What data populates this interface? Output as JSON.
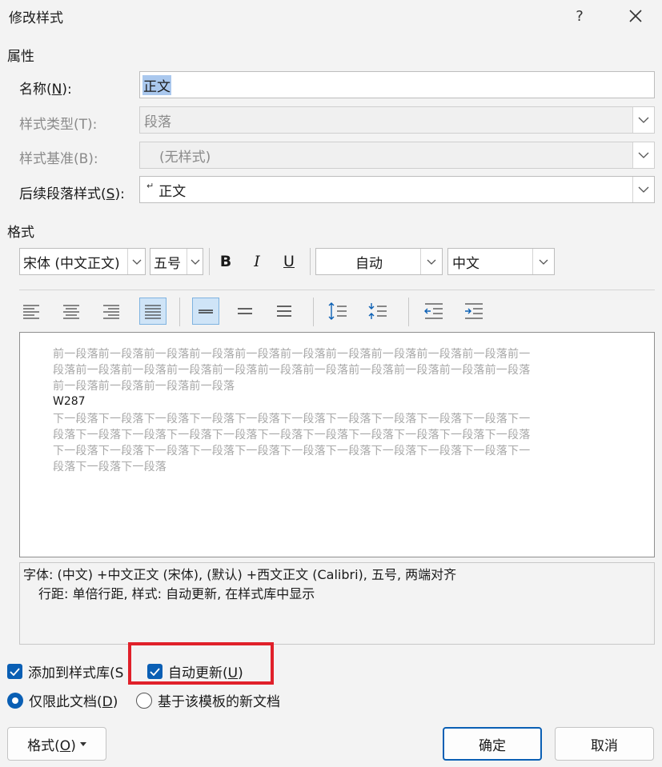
{
  "window": {
    "title": "修改样式",
    "help": "?"
  },
  "properties": {
    "heading": "属性",
    "name_label": "名称(",
    "name_key": "N",
    "name_label_end": "):",
    "name_value": "正文",
    "type_label": "样式类型(T):",
    "type_value": "段落",
    "based_label": "样式基准(B):",
    "based_value": "(无样式)",
    "next_label": "后续段落样式(",
    "next_key": "S",
    "next_label_end": "):",
    "next_value": "正文",
    "next_marker": "↵"
  },
  "format": {
    "heading": "格式",
    "font": "宋体 (中文正文)",
    "size": "五号",
    "bold": "B",
    "italic": "I",
    "underline": "U",
    "color": "自动",
    "language": "中文"
  },
  "preview": {
    "prev_lines": [
      "前一段落前一段落前一段落前一段落前一段落前一段落前一段落前一段落前一段落前一段落前一",
      "段落前一段落前一段落前一段落前一段落前一段落前一段落前一段落前一段落前一段落前一段落",
      "前一段落前一段落前一段落前一段落"
    ],
    "sample": "W287",
    "next_lines": [
      "下一段落下一段落下一段落下一段落下一段落下一段落下一段落下一段落下一段落下一段落下一",
      "段落下一段落下一段落下一段落下一段落下一段落下一段落下一段落下一段落下一段落下一段落",
      "下一段落下一段落下一段落下一段落下一段落下一段落下一段落下一段落下一段落下一段落下一",
      "段落下一段落下一段落"
    ]
  },
  "description": {
    "line1": "字体: (中文) +中文正文 (宋体), (默认) +西文正文 (Calibri), 五号, 两端对齐",
    "line2": "行距: 单倍行距, 样式: 自动更新, 在样式库中显示"
  },
  "options": {
    "add_gallery": "添加到样式库(S",
    "auto_update_pre": "自动更新(",
    "auto_update_key": "U",
    "auto_update_end": ")",
    "only_doc_pre": "仅限此文档(",
    "only_doc_key": "D",
    "only_doc_end": ")",
    "template": "基于该模板的新文档"
  },
  "buttons": {
    "format_pre": "格式(",
    "format_key": "O",
    "format_end": ")",
    "ok": "确定",
    "cancel": "取消"
  },
  "colors": {
    "accent": "#0a5fb4",
    "highlight": "#e0202a"
  }
}
